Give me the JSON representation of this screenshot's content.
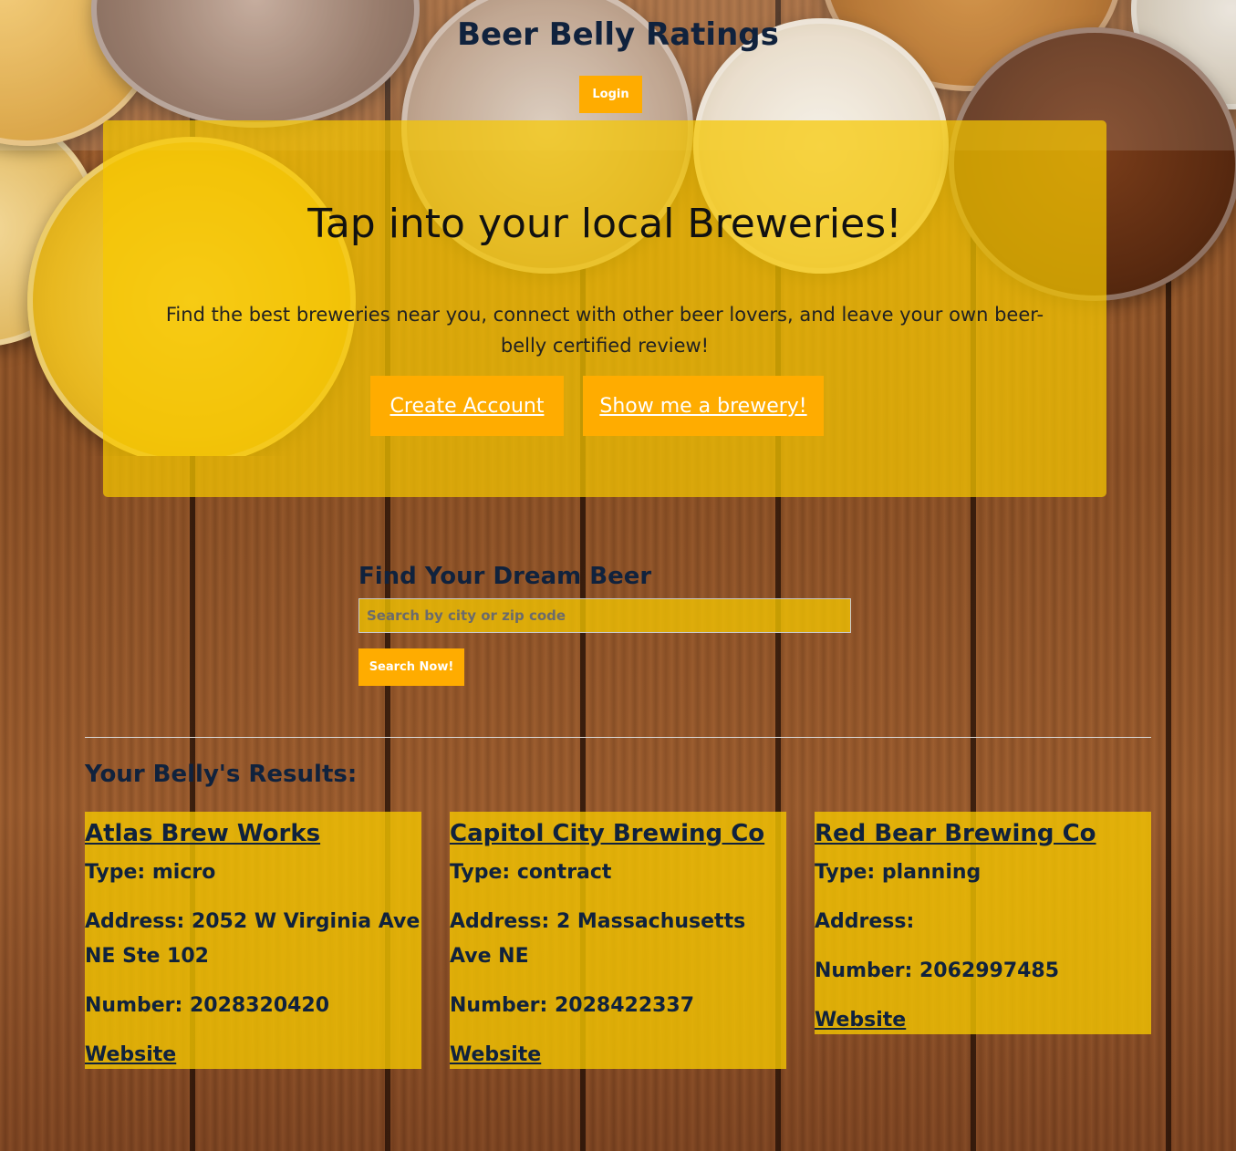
{
  "header": {
    "title": "Beer Belly Ratings",
    "login_label": "Login"
  },
  "hero": {
    "title": "Tap into your local Breweries!",
    "text": "Find the best breweries near you, connect with other beer lovers, and leave your own beer-belly certified review!",
    "create_account_label": "Create Account",
    "show_brewery_label": "Show me a brewery!"
  },
  "search": {
    "heading": "Find Your Dream Beer",
    "placeholder": "Search by city or zip code",
    "value": "",
    "button_label": "Search Now!"
  },
  "results": {
    "heading": "Your Belly's Results:",
    "breweries": [
      {
        "name": "Atlas Brew Works",
        "type": "Type: micro",
        "address": "Address: 2052 W Virginia Ave NE Ste 102",
        "number": "Number: 2028320420",
        "website_label": "Website"
      },
      {
        "name": "Capitol City Brewing Co",
        "type": "Type: contract",
        "address": "Address: 2 Massachusetts Ave NE",
        "number": "Number: 2028422337",
        "website_label": "Website"
      },
      {
        "name": "Red Bear Brewing Co",
        "type": "Type: planning",
        "address": "Address:",
        "number": "Number: 2062997485",
        "website_label": "Website"
      }
    ]
  },
  "colors": {
    "accent": "#ffac00",
    "panel": "#f6c800",
    "text_dark": "#10223d"
  }
}
